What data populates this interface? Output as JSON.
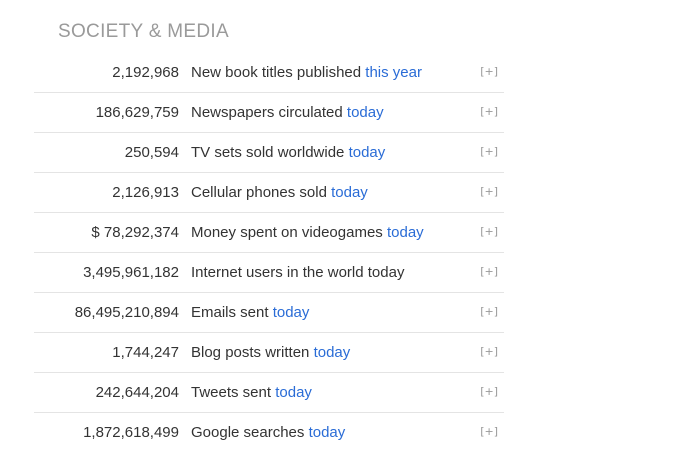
{
  "section": {
    "title": "SOCIETY & MEDIA"
  },
  "rows": [
    {
      "value": "2,192,968",
      "label": "New book titles published",
      "period": "this year",
      "period_linked": true,
      "toggle": "[+]"
    },
    {
      "value": "186,629,759",
      "label": "Newspapers circulated",
      "period": "today",
      "period_linked": true,
      "toggle": "[+]"
    },
    {
      "value": "250,594",
      "label": "TV sets sold worldwide",
      "period": "today",
      "period_linked": true,
      "toggle": "[+]"
    },
    {
      "value": "2,126,913",
      "label": "Cellular phones sold",
      "period": "today",
      "period_linked": true,
      "toggle": "[+]"
    },
    {
      "value": "$ 78,292,374",
      "label": "Money spent on videogames",
      "period": "today",
      "period_linked": true,
      "toggle": "[+]"
    },
    {
      "value": "3,495,961,182",
      "label": "Internet users in the world today",
      "period": "",
      "period_linked": false,
      "toggle": "[+]"
    },
    {
      "value": "86,495,210,894",
      "label": "Emails sent",
      "period": "today",
      "period_linked": true,
      "toggle": "[+]"
    },
    {
      "value": "1,744,247",
      "label": "Blog posts written",
      "period": "today",
      "period_linked": true,
      "toggle": "[+]"
    },
    {
      "value": "242,644,204",
      "label": "Tweets sent",
      "period": "today",
      "period_linked": true,
      "toggle": "[+]"
    },
    {
      "value": "1,872,618,499",
      "label": "Google searches",
      "period": "today",
      "period_linked": true,
      "toggle": "[+]"
    }
  ],
  "colors": {
    "link": "#2a6cd6",
    "title": "#9a9a9a",
    "text": "#333333",
    "divider": "#e4e4e4"
  }
}
